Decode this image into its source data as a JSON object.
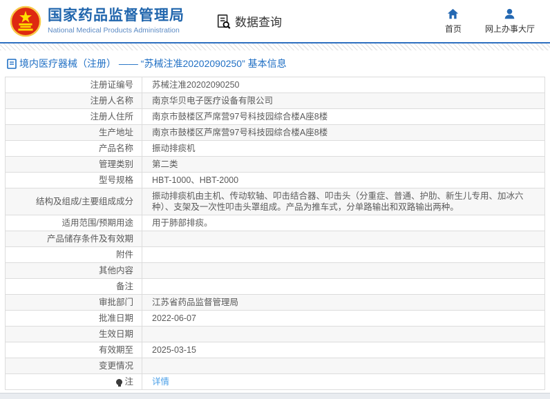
{
  "header": {
    "title": "国家药品监督管理局",
    "subtitle": "National Medical Products Administration",
    "section_label": "数据查询",
    "nav": [
      {
        "label": "首页",
        "icon": "home-icon"
      },
      {
        "label": "网上办事大厅",
        "icon": "person-icon"
      }
    ]
  },
  "breadcrumb": {
    "text": "境内医疗器械（注册） —— “苏械注准20202090250” 基本信息"
  },
  "table": {
    "rows": [
      {
        "label": "注册证编号",
        "value": "苏械注准20202090250"
      },
      {
        "label": "注册人名称",
        "value": "南京华贝电子医疗设备有限公司"
      },
      {
        "label": "注册人住所",
        "value": "南京市鼓楼区芦席营97号科技园综合楼A座8楼"
      },
      {
        "label": "生产地址",
        "value": "南京市鼓楼区芦席营97号科技园综合楼A座8楼"
      },
      {
        "label": "产品名称",
        "value": "振动排痰机"
      },
      {
        "label": "管理类别",
        "value": "第二类"
      },
      {
        "label": "型号规格",
        "value": "HBT-1000、HBT-2000"
      },
      {
        "label": "结构及组成/主要组成成分",
        "value": "振动排痰机由主机、传动软轴、叩击结合器、叩击头（分重症、普通、护肋、新生儿专用、加冰六种）、支架及一次性叩击头罩组成。产品为推车式，分单路输出和双路输出两种。"
      },
      {
        "label": "适用范围/预期用途",
        "value": "用于肺部排痰。"
      },
      {
        "label": "产品储存条件及有效期",
        "value": ""
      },
      {
        "label": "附件",
        "value": ""
      },
      {
        "label": "其他内容",
        "value": ""
      },
      {
        "label": "备注",
        "value": ""
      },
      {
        "label": "审批部门",
        "value": "江苏省药品监督管理局"
      },
      {
        "label": "批准日期",
        "value": "2022-06-07"
      },
      {
        "label": "生效日期",
        "value": ""
      },
      {
        "label": "有效期至",
        "value": "2025-03-15"
      },
      {
        "label": "变更情况",
        "value": ""
      },
      {
        "label": "注",
        "value": "详情",
        "value_is_link": true,
        "label_icon": "note-icon"
      }
    ]
  },
  "colors": {
    "brand-blue": "#2166ad",
    "link-blue": "#4ba0e8",
    "border-gray": "#dcdcdc",
    "row-alt": "#f7f7f7",
    "emblem_red": "#de2910",
    "emblem_yellow": "#ffde00"
  }
}
